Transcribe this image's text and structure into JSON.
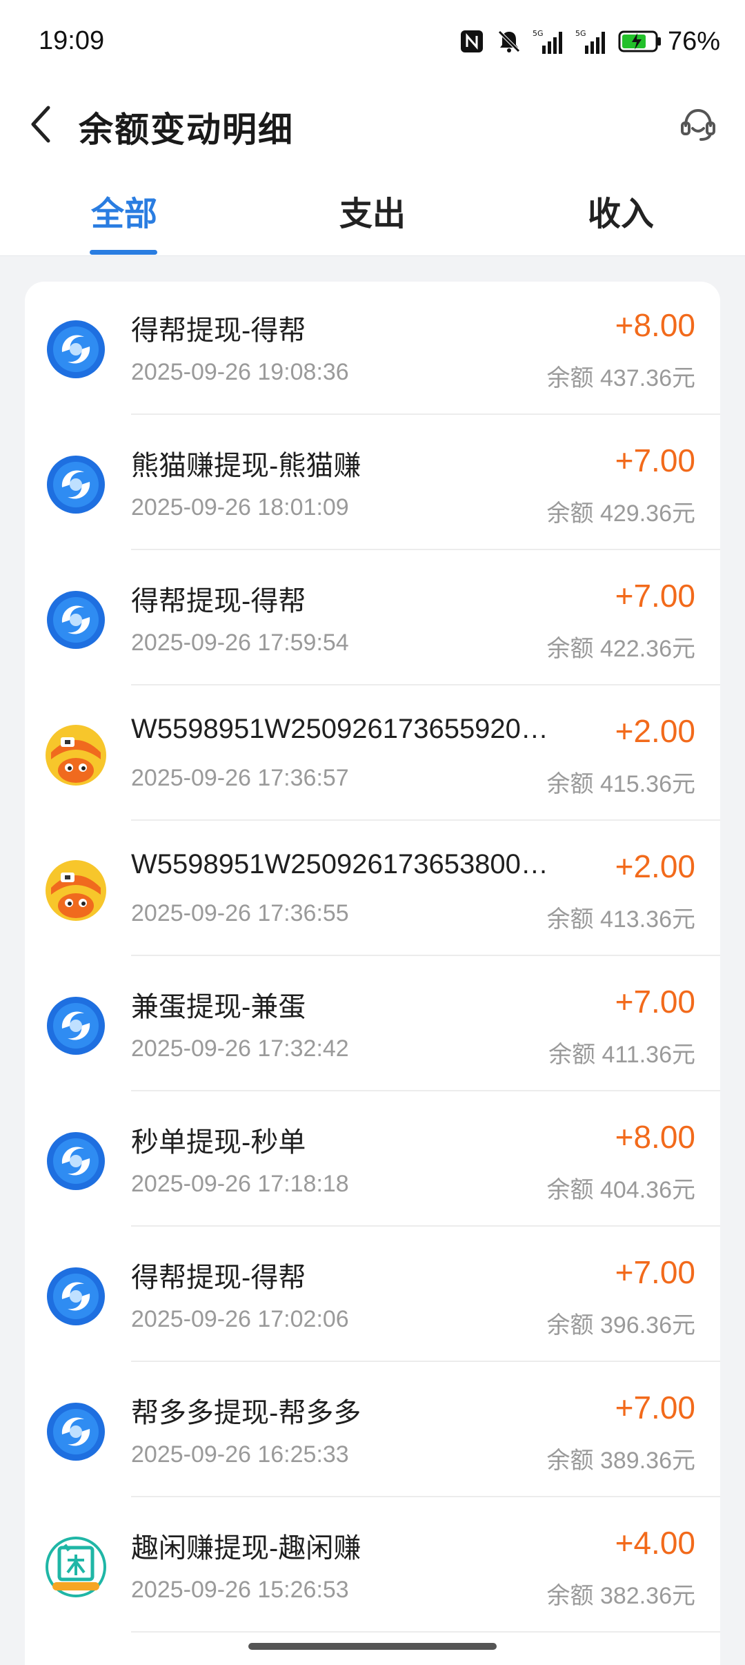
{
  "status_bar": {
    "time": "19:09",
    "battery_percent": "76%",
    "icons": [
      "nfc-icon",
      "mute-bell-icon",
      "signal-5g-icon",
      "signal-5g-icon",
      "battery-charging-icon"
    ]
  },
  "header": {
    "title": "余额变动明细",
    "back_icon": "chevron-left-icon",
    "service_icon": "customer-service-icon"
  },
  "tabs": [
    {
      "label": "全部",
      "active": true
    },
    {
      "label": "支出",
      "active": false
    },
    {
      "label": "收入",
      "active": false
    }
  ],
  "colors": {
    "accent": "#2a7de1",
    "amount": "#f26a1b",
    "secondary_text": "#9a9a9a"
  },
  "transactions": [
    {
      "title": "得帮提现-得帮",
      "time": "2025-09-26 19:08:36",
      "amount": "+8.00",
      "balance": "余额 437.36元",
      "avatar": "swirl"
    },
    {
      "title": "熊猫赚提现-熊猫赚",
      "time": "2025-09-26 18:01:09",
      "amount": "+7.00",
      "balance": "余额 429.36元",
      "avatar": "swirl"
    },
    {
      "title": "得帮提现-得帮",
      "time": "2025-09-26 17:59:54",
      "amount": "+7.00",
      "balance": "余额 422.36元",
      "avatar": "swirl"
    },
    {
      "title": "W5598951W250926173655920…",
      "time": "2025-09-26 17:36:57",
      "amount": "+2.00",
      "balance": "余额 415.36元",
      "avatar": "mascot"
    },
    {
      "title": "W5598951W250926173653800…",
      "time": "2025-09-26 17:36:55",
      "amount": "+2.00",
      "balance": "余额 413.36元",
      "avatar": "mascot"
    },
    {
      "title": "兼蛋提现-兼蛋",
      "time": "2025-09-26 17:32:42",
      "amount": "+7.00",
      "balance": "余额 411.36元",
      "avatar": "swirl"
    },
    {
      "title": "秒单提现-秒单",
      "time": "2025-09-26 17:18:18",
      "amount": "+8.00",
      "balance": "余额 404.36元",
      "avatar": "swirl"
    },
    {
      "title": "得帮提现-得帮",
      "time": "2025-09-26 17:02:06",
      "amount": "+7.00",
      "balance": "余额 396.36元",
      "avatar": "swirl"
    },
    {
      "title": "帮多多提现-帮多多",
      "time": "2025-09-26 16:25:33",
      "amount": "+7.00",
      "balance": "余额 389.36元",
      "avatar": "swirl"
    },
    {
      "title": "趣闲赚提现-趣闲赚",
      "time": "2025-09-26 15:26:53",
      "amount": "+4.00",
      "balance": "余额 382.36元",
      "avatar": "xian"
    }
  ]
}
